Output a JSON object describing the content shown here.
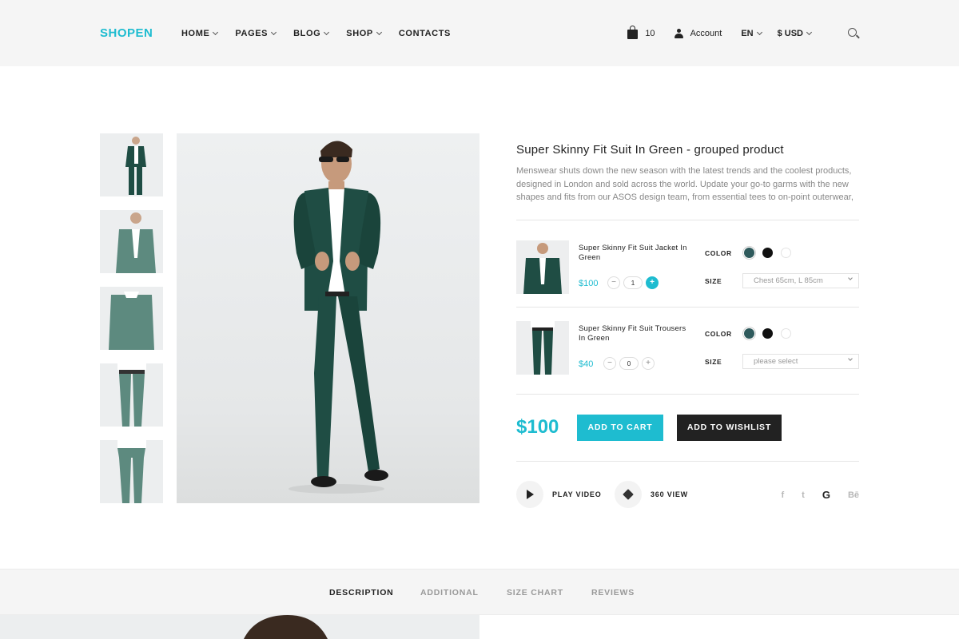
{
  "header": {
    "logo": "SHOPEN",
    "nav": [
      {
        "label": "HOME",
        "has_dropdown": true
      },
      {
        "label": "PAGES",
        "has_dropdown": true
      },
      {
        "label": "BLOG",
        "has_dropdown": true
      },
      {
        "label": "SHOP",
        "has_dropdown": true
      },
      {
        "label": "CONTACTS",
        "has_dropdown": false
      }
    ],
    "cart_count": "10",
    "account_label": "Account",
    "language": "EN",
    "currency": "$ USD"
  },
  "product": {
    "title": "Super Skinny Fit Suit In Green - grouped product",
    "description": "Menswear shuts down the new season with the latest trends and the coolest products, designed in London and sold across the world. Update your go-to garms with the new shapes and fits from our ASOS design team, from essential tees to on-point outerwear,",
    "price": "$100",
    "add_to_cart": "ADD TO CART",
    "add_to_wishlist": "ADD TO WISHLIST"
  },
  "grouped_items": [
    {
      "name": "Super Skinny Fit Suit Jacket In Green",
      "price": "$100",
      "qty": "1",
      "color_label": "COLOR",
      "size_label": "SIZE",
      "size_value": "Chest 65cm, L 85cm"
    },
    {
      "name": "Super Skinny Fit Suit Trousers In Green",
      "price": "$40",
      "qty": "0",
      "color_label": "COLOR",
      "size_label": "SIZE",
      "size_value": "please select"
    }
  ],
  "swatch_colors": [
    "#2f5a5c",
    "#111111",
    "#ffffff"
  ],
  "media": {
    "play_video": "PLAY VIDEO",
    "view_360": "360 VIEW"
  },
  "socials": [
    "f",
    "t",
    "G",
    "Bē"
  ],
  "tabs": [
    "DESCRIPTION",
    "ADDITIONAL",
    "SIZE CHART",
    "REVIEWS"
  ],
  "colors": {
    "accent": "#1ebcd0",
    "dark": "#222222",
    "suit_green": "#1f4d44"
  }
}
